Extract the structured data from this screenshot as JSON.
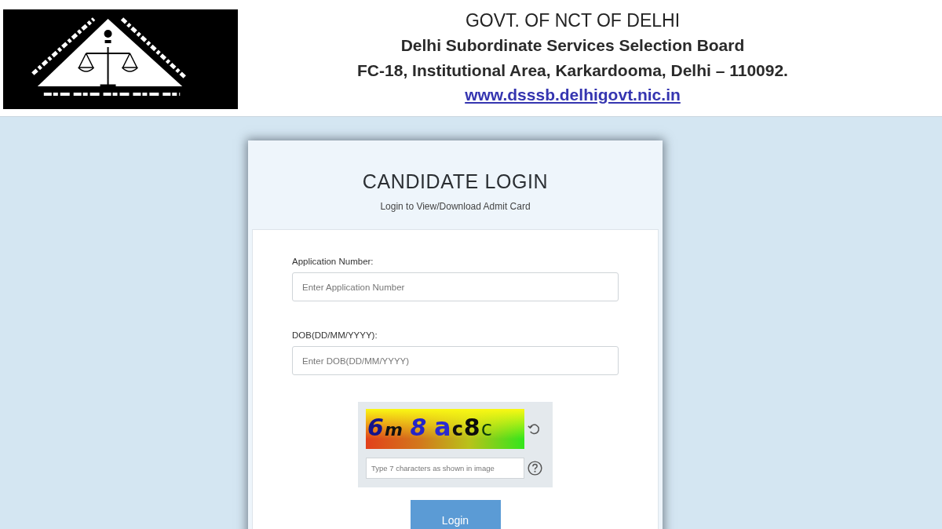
{
  "header": {
    "lines": [
      "GOVT. OF NCT OF DELHI",
      "Delhi Subordinate Services Selection Board",
      "FC-18, Institutional Area, Karkardooma, Delhi – 110092."
    ],
    "link": "www.dsssb.delhigovt.nic.in"
  },
  "login_card": {
    "title": "CANDIDATE LOGIN",
    "subtitle": "Login to View/Download Admit Card",
    "fields": [
      {
        "label": "Application Number:",
        "placeholder": "Enter Application Number"
      },
      {
        "label": "DOB(DD/MM/YYYY):",
        "placeholder": "Enter DOB(DD/MM/YYYY)"
      }
    ],
    "captcha": {
      "text": "6m 8 ac8c",
      "placeholder": "Type 7 characters as shown in image"
    },
    "button": "Login"
  }
}
